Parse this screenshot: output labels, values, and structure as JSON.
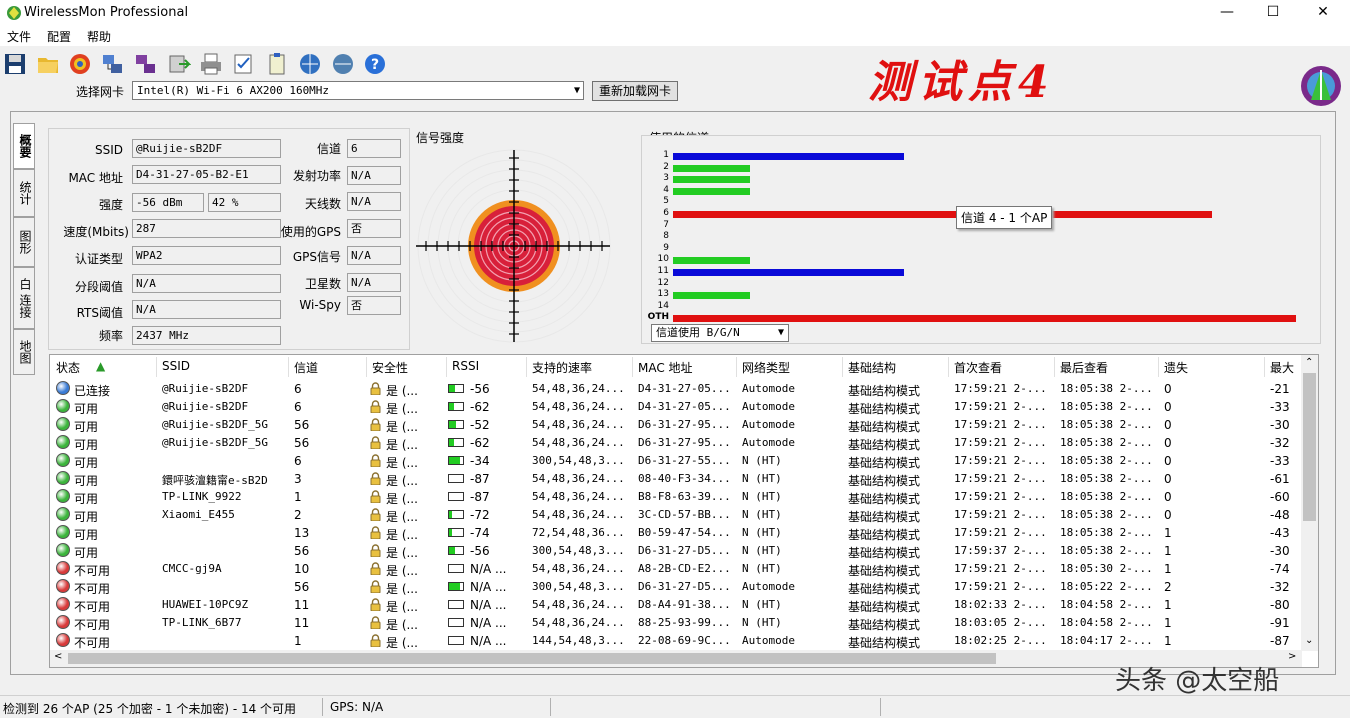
{
  "window": {
    "title": "WirelessMon Professional",
    "minimize": "—",
    "maximize": "☐",
    "close": "✕"
  },
  "menu": {
    "file": "文件",
    "config": "配置",
    "help": "帮助"
  },
  "overlay_title": "测试点4",
  "adapter": {
    "label": "选择网卡",
    "value": "Intel(R) Wi-Fi 6 AX200 160MHz",
    "reload": "重新加载网卡"
  },
  "tabs": [
    "概要",
    "统计",
    "图形",
    "白 连接",
    "地图"
  ],
  "info": {
    "ssid_label": "SSID",
    "ssid": "@Ruijie-sB2DF",
    "mac_label": "MAC 地址",
    "mac": "D4-31-27-05-B2-E1",
    "strength_label": "强度",
    "strength_dbm": "-56 dBm",
    "strength_pct": "42 %",
    "speed_label": "速度(Mbits)",
    "speed": "287",
    "auth_label": "认证类型",
    "auth": "WPA2",
    "frag_label": "分段阈值",
    "frag": "N/A",
    "rts_label": "RTS阈值",
    "rts": "N/A",
    "freq_label": "频率",
    "freq": "2437 MHz",
    "channel_label": "信道",
    "channel": "6",
    "txpower_label": "发射功率",
    "txpower": "N/A",
    "antenna_label": "天线数",
    "antenna": "N/A",
    "gps_used_label": "使用的GPS",
    "gps_used": "否",
    "gps_signal_label": "GPS信号",
    "gps_signal": "N/A",
    "satellites_label": "卫星数",
    "satellites": "N/A",
    "wispy_label": "Wi-Spy",
    "wispy": "否"
  },
  "signal": {
    "title": "信号强度",
    "percent": 42
  },
  "channels": {
    "title": "使用的信道",
    "labels": [
      "1",
      "2",
      "3",
      "4",
      "5",
      "6",
      "7",
      "8",
      "9",
      "10",
      "11",
      "12",
      "13",
      "14",
      "OTH"
    ],
    "bars": [
      {
        "ch": "1",
        "len": 0.36,
        "color": "#0a0ad8"
      },
      {
        "ch": "2",
        "len": 0.12,
        "color": "#22cc22"
      },
      {
        "ch": "3",
        "len": 0.12,
        "color": "#22cc22"
      },
      {
        "ch": "4",
        "len": 0.12,
        "color": "#22cc22"
      },
      {
        "ch": "6",
        "len": 0.84,
        "color": "#e01010"
      },
      {
        "ch": "10",
        "len": 0.12,
        "color": "#22cc22"
      },
      {
        "ch": "11",
        "len": 0.36,
        "color": "#0a0ad8"
      },
      {
        "ch": "13",
        "len": 0.12,
        "color": "#22cc22"
      },
      {
        "ch": "OTH",
        "len": 0.97,
        "color": "#e01010"
      }
    ],
    "tooltip": "信道 4 - 1 个AP",
    "mode": "信道使用 B/G/N"
  },
  "table": {
    "headers": [
      "状态",
      "SSID",
      "信道",
      "安全性",
      "RSSI",
      "支持的速率",
      "MAC 地址",
      "网络类型",
      "基础结构",
      "首次查看",
      "最后查看",
      "遗失",
      "最大"
    ],
    "sort_arrow": "▲",
    "rows": [
      {
        "status": "已连接",
        "color": "#3a7bd5",
        "ssid": "@Ruijie-sB2DF",
        "ch": "6",
        "sec": "是 (...",
        "rssi": "-56",
        "fill": 0.42,
        "rates": "54,48,36,24...",
        "mac": "D4-31-27-05...",
        "type": "Automode",
        "infra": "基础结构模式",
        "first": "17:59:21 2-...",
        "last": "18:05:38 2-...",
        "lost": "0",
        "max": "-21"
      },
      {
        "status": "可用",
        "color": "#3cb43c",
        "ssid": "@Ruijie-sB2DF",
        "ch": "6",
        "sec": "是 (...",
        "rssi": "-62",
        "fill": 0.35,
        "rates": "54,48,36,24...",
        "mac": "D4-31-27-05...",
        "type": "Automode",
        "infra": "基础结构模式",
        "first": "17:59:21 2-...",
        "last": "18:05:38 2-...",
        "lost": "0",
        "max": "-33"
      },
      {
        "status": "可用",
        "color": "#3cb43c",
        "ssid": "@Ruijie-sB2DF_5G",
        "ch": "56",
        "sec": "是 (...",
        "rssi": "-52",
        "fill": 0.48,
        "rates": "54,48,36,24...",
        "mac": "D6-31-27-95...",
        "type": "Automode",
        "infra": "基础结构模式",
        "first": "17:59:21 2-...",
        "last": "18:05:38 2-...",
        "lost": "0",
        "max": "-30"
      },
      {
        "status": "可用",
        "color": "#3cb43c",
        "ssid": "@Ruijie-sB2DF_5G",
        "ch": "56",
        "sec": "是 (...",
        "rssi": "-62",
        "fill": 0.35,
        "rates": "54,48,36,24...",
        "mac": "D6-31-27-95...",
        "type": "Automode",
        "infra": "基础结构模式",
        "first": "17:59:21 2-...",
        "last": "18:05:38 2-...",
        "lost": "0",
        "max": "-32"
      },
      {
        "status": "可用",
        "color": "#3cb43c",
        "ssid": "",
        "ch": "6",
        "sec": "是 (...",
        "rssi": "-34",
        "fill": 0.8,
        "rates": "300,54,48,3...",
        "mac": "D6-31-27-55...",
        "type": "N (HT)",
        "infra": "基础结构模式",
        "first": "17:59:21 2-...",
        "last": "18:05:38 2-...",
        "lost": "0",
        "max": "-33"
      },
      {
        "status": "可用",
        "color": "#3cb43c",
        "ssid": "鐶呯骇澶籍甯e-sB2D",
        "ch": "3",
        "sec": "是 (...",
        "rssi": "-87",
        "fill": 0.0,
        "rates": "54,48,36,24...",
        "mac": "08-40-F3-34...",
        "type": "N (HT)",
        "infra": "基础结构模式",
        "first": "17:59:21 2-...",
        "last": "18:05:38 2-...",
        "lost": "0",
        "max": "-61"
      },
      {
        "status": "可用",
        "color": "#3cb43c",
        "ssid": "TP-LINK_9922",
        "ch": "1",
        "sec": "是 (...",
        "rssi": "-87",
        "fill": 0.0,
        "rates": "54,48,36,24...",
        "mac": "B8-F8-63-39...",
        "type": "N (HT)",
        "infra": "基础结构模式",
        "first": "17:59:21 2-...",
        "last": "18:05:38 2-...",
        "lost": "0",
        "max": "-60"
      },
      {
        "status": "可用",
        "color": "#3cb43c",
        "ssid": "Xiaomi_E455",
        "ch": "2",
        "sec": "是 (...",
        "rssi": "-72",
        "fill": 0.2,
        "rates": "54,48,36,24...",
        "mac": "3C-CD-57-BB...",
        "type": "N (HT)",
        "infra": "基础结构模式",
        "first": "17:59:21 2-...",
        "last": "18:05:38 2-...",
        "lost": "0",
        "max": "-48"
      },
      {
        "status": "可用",
        "color": "#3cb43c",
        "ssid": "",
        "ch": "13",
        "sec": "是 (...",
        "rssi": "-74",
        "fill": 0.18,
        "rates": "72,54,48,36...",
        "mac": "B0-59-47-54...",
        "type": "N (HT)",
        "infra": "基础结构模式",
        "first": "17:59:21 2-...",
        "last": "18:05:38 2-...",
        "lost": "1",
        "max": "-43"
      },
      {
        "status": "可用",
        "color": "#3cb43c",
        "ssid": "",
        "ch": "56",
        "sec": "是 (...",
        "rssi": "-56",
        "fill": 0.42,
        "rates": "300,54,48,3...",
        "mac": "D6-31-27-D5...",
        "type": "N (HT)",
        "infra": "基础结构模式",
        "first": "17:59:37 2-...",
        "last": "18:05:38 2-...",
        "lost": "1",
        "max": "-30"
      },
      {
        "status": "不可用",
        "color": "#d83a3a",
        "ssid": "CMCC-gj9A",
        "ch": "10",
        "sec": "是 (...",
        "rssi": "N/A ...",
        "fill": 0.0,
        "rates": "54,48,36,24...",
        "mac": "A8-2B-CD-E2...",
        "type": "N (HT)",
        "infra": "基础结构模式",
        "first": "17:59:21 2-...",
        "last": "18:05:30 2-...",
        "lost": "1",
        "max": "-74"
      },
      {
        "status": "不可用",
        "color": "#d83a3a",
        "ssid": "",
        "ch": "56",
        "sec": "是 (...",
        "rssi": "N/A ...",
        "fill": 0.8,
        "rates": "300,54,48,3...",
        "mac": "D6-31-27-D5...",
        "type": "Automode",
        "infra": "基础结构模式",
        "first": "17:59:21 2-...",
        "last": "18:05:22 2-...",
        "lost": "2",
        "max": "-32"
      },
      {
        "status": "不可用",
        "color": "#d83a3a",
        "ssid": "HUAWEI-10PC9Z",
        "ch": "11",
        "sec": "是 (...",
        "rssi": "N/A ...",
        "fill": 0.0,
        "rates": "54,48,36,24...",
        "mac": "D8-A4-91-38...",
        "type": "N (HT)",
        "infra": "基础结构模式",
        "first": "18:02:33 2-...",
        "last": "18:04:58 2-...",
        "lost": "1",
        "max": "-80"
      },
      {
        "status": "不可用",
        "color": "#d83a3a",
        "ssid": "TP-LINK_6B77",
        "ch": "11",
        "sec": "是 (...",
        "rssi": "N/A ...",
        "fill": 0.0,
        "rates": "54,48,36,24...",
        "mac": "88-25-93-99...",
        "type": "N (HT)",
        "infra": "基础结构模式",
        "first": "18:03:05 2-...",
        "last": "18:04:58 2-...",
        "lost": "1",
        "max": "-91"
      },
      {
        "status": "不可用",
        "color": "#d83a3a",
        "ssid": "",
        "ch": "1",
        "sec": "是 (...",
        "rssi": "N/A ...",
        "fill": 0.0,
        "rates": "144,54,48,3...",
        "mac": "22-08-69-9C...",
        "type": "Automode",
        "infra": "基础结构模式",
        "first": "18:02:25 2-...",
        "last": "18:04:17 2-...",
        "lost": "1",
        "max": "-87"
      }
    ]
  },
  "status": {
    "ap_count": "检测到 26 个AP (25 个加密 - 1 个未加密) - 14 个可用",
    "gps": "GPS: N/A"
  },
  "brand_watermark": "头条 @太空船"
}
